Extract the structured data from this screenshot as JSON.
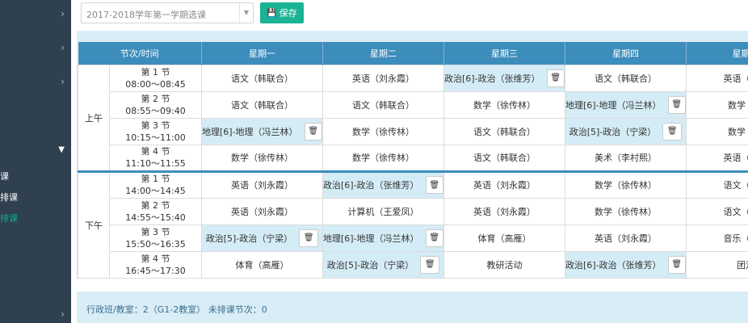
{
  "toolbar": {
    "semester_value": "2017-2018学年第一学期选课",
    "save_label": "保存"
  },
  "sidebar": {
    "items": [
      "课",
      "排课",
      "排课"
    ]
  },
  "timetable": {
    "headers": [
      "节次/时间",
      "星期一",
      "星期二",
      "星期三",
      "星期四",
      "星期五"
    ],
    "halves": [
      "上午",
      "下午"
    ],
    "rows": [
      {
        "period": "第 1 节",
        "time": "08:00～08:45",
        "cells": [
          {
            "text": "语文（韩联合）",
            "hl": false
          },
          {
            "text": "英语（刘永霞）",
            "hl": false
          },
          {
            "text": "政治[6]-政治（张维芳）",
            "hl": true
          },
          {
            "text": "语文（韩联合）",
            "hl": false
          },
          {
            "text": "英语（刘永",
            "hl": false
          }
        ]
      },
      {
        "period": "第 2 节",
        "time": "08:55～09:40",
        "cells": [
          {
            "text": "语文（韩联合）",
            "hl": false
          },
          {
            "text": "语文（韩联合）",
            "hl": false
          },
          {
            "text": "数学（徐传林）",
            "hl": false
          },
          {
            "text": "地理[6]-地理（冯兰林）",
            "hl": true
          },
          {
            "text": "数学（徐",
            "hl": false
          }
        ]
      },
      {
        "period": "第 3 节",
        "time": "10:15～11:00",
        "cells": [
          {
            "text": "地理[6]-地理（冯兰林）",
            "hl": true
          },
          {
            "text": "数学（徐传林）",
            "hl": false
          },
          {
            "text": "语文（韩联合）",
            "hl": false
          },
          {
            "text": "政治[5]-政治（宁梁）",
            "hl": true
          },
          {
            "text": "数学（徐",
            "hl": false
          }
        ]
      },
      {
        "period": "第 4 节",
        "time": "11:10～11:55",
        "cells": [
          {
            "text": "数学（徐传林）",
            "hl": false
          },
          {
            "text": "数学（徐传林）",
            "hl": false
          },
          {
            "text": "语文（韩联合）",
            "hl": false
          },
          {
            "text": "美术（李村熙）",
            "hl": false
          },
          {
            "text": "英语（刘永",
            "hl": false
          }
        ]
      },
      {
        "period": "第 1 节",
        "time": "14:00～14:45",
        "cells": [
          {
            "text": "英语（刘永霞）",
            "hl": false
          },
          {
            "text": "政治[6]-政治（张维芳）",
            "hl": true
          },
          {
            "text": "英语（刘永霞）",
            "hl": false
          },
          {
            "text": "数学（徐传林）",
            "hl": false
          },
          {
            "text": "语文（韩联",
            "hl": false
          }
        ]
      },
      {
        "period": "第 2 节",
        "time": "14:55～15:40",
        "cells": [
          {
            "text": "英语（刘永霞）",
            "hl": false
          },
          {
            "text": "计算机（王爱凤）",
            "hl": false
          },
          {
            "text": "英语（刘永霞）",
            "hl": false
          },
          {
            "text": "数学（徐传林）",
            "hl": false
          },
          {
            "text": "语文（韩联",
            "hl": false
          }
        ]
      },
      {
        "period": "第 3 节",
        "time": "15:50～16:35",
        "cells": [
          {
            "text": "政治[5]-政治（宁梁）",
            "hl": true
          },
          {
            "text": "地理[6]-地理（冯兰林）",
            "hl": true
          },
          {
            "text": "体育（高雁）",
            "hl": false
          },
          {
            "text": "英语（刘永霞）",
            "hl": false
          },
          {
            "text": "音乐（张道",
            "hl": false
          }
        ]
      },
      {
        "period": "第 4 节",
        "time": "16:45～17:30",
        "cells": [
          {
            "text": "体育（高雁）",
            "hl": false
          },
          {
            "text": "政治[5]-政治（宁梁）",
            "hl": true
          },
          {
            "text": "教研活动",
            "hl": false
          },
          {
            "text": "政治[6]-政治（张维芳）",
            "hl": true
          },
          {
            "text": "团活",
            "hl": false
          }
        ]
      }
    ]
  },
  "footer": {
    "text": "行政班/教室：2（G1-2教室） 未排课节次：0"
  },
  "icons": {
    "save": "floppy-disk-icon",
    "delete": "trash-icon"
  }
}
